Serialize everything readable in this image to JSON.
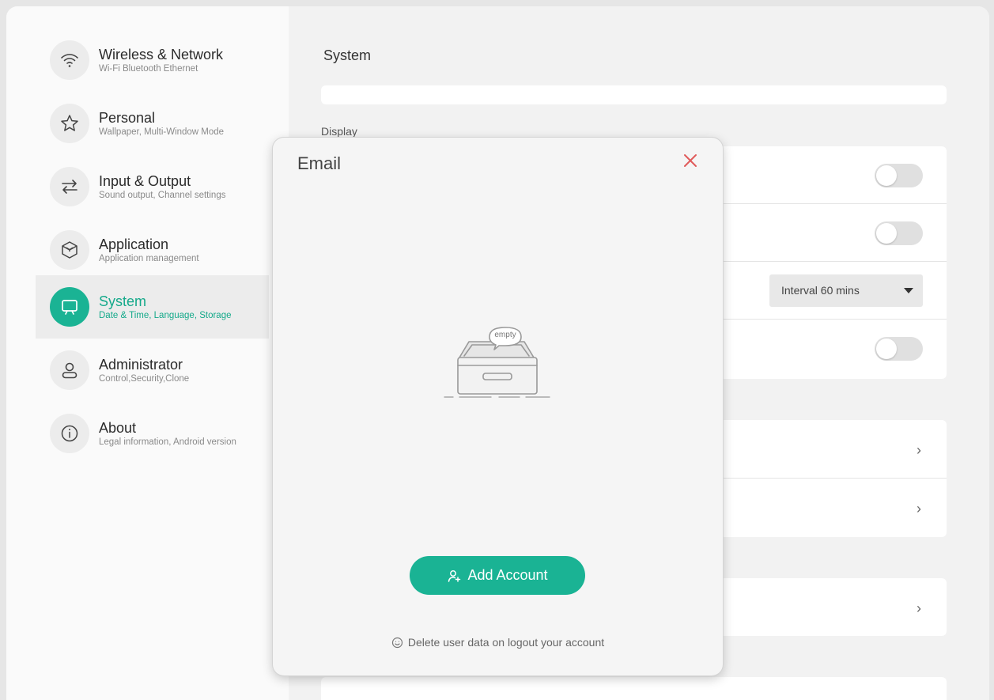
{
  "sidebar": {
    "items": [
      {
        "icon": "wifi-icon",
        "title": "Wireless & Network",
        "subtitle": "Wi-Fi Bluetooth Ethernet"
      },
      {
        "icon": "star-icon",
        "title": "Personal",
        "subtitle": "Wallpaper, Multi-Window Mode"
      },
      {
        "icon": "swap-arrows-icon",
        "title": "Input & Output",
        "subtitle": "Sound output, Channel settings"
      },
      {
        "icon": "cube-icon",
        "title": "Application",
        "subtitle": "Application management"
      },
      {
        "icon": "presentation-screen-icon",
        "title": "System",
        "subtitle": "Date & Time, Language, Storage"
      },
      {
        "icon": "user-icon",
        "title": "Administrator",
        "subtitle": "Control,Security,Clone"
      },
      {
        "icon": "info-icon",
        "title": "About",
        "subtitle": "Legal information, Android version"
      }
    ],
    "active_index": 4
  },
  "main": {
    "title": "System",
    "display_section_label": "Display",
    "dropdown_value": "Interval 60 mins"
  },
  "modal": {
    "title": "Email",
    "empty_label": "empty",
    "add_account_label": "Add Account",
    "footnote": "Delete user data on logout your account"
  },
  "colors": {
    "accent": "#1ab394",
    "close": "#e05a5a"
  }
}
